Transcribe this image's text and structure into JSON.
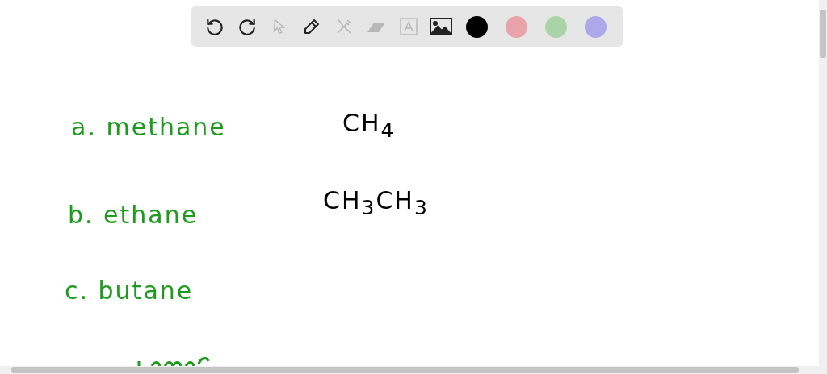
{
  "toolbar": {
    "tools": [
      {
        "kind": "undo",
        "disabled": false
      },
      {
        "kind": "redo",
        "disabled": false
      },
      {
        "kind": "select",
        "disabled": true
      },
      {
        "kind": "pen",
        "disabled": false
      },
      {
        "kind": "tools",
        "disabled": true
      },
      {
        "kind": "eraser",
        "disabled": true
      },
      {
        "kind": "text",
        "disabled": true
      },
      {
        "kind": "image",
        "disabled": false
      }
    ],
    "colors": [
      {
        "color": "#000000"
      },
      {
        "color": "#e8a4aa"
      },
      {
        "color": "#aad4a8"
      },
      {
        "color": "#aca8ea"
      }
    ]
  },
  "notes": [
    {
      "text": "a. methane",
      "color": "#1e9a1e"
    },
    {
      "text": "CH$_{4}$",
      "color": "#000000"
    },
    {
      "text": "b. ethane",
      "color": "#1e9a1e"
    },
    {
      "text": "CH$_{3}$CH$_{3}$",
      "color": "#000000"
    },
    {
      "text": "c. butane",
      "color": "#1e9a1e"
    }
  ]
}
